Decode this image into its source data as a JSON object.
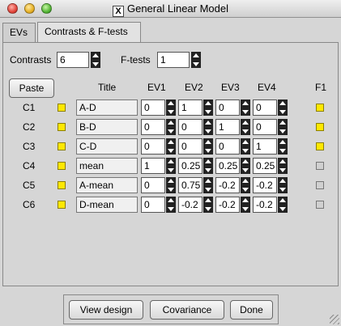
{
  "window": {
    "title": "General Linear Model"
  },
  "tabs": [
    {
      "label": "EVs"
    },
    {
      "label": "Contrasts & F-tests"
    }
  ],
  "counts": {
    "contrasts_label": "Contrasts",
    "contrasts_value": "6",
    "ftests_label": "F-tests",
    "ftests_value": "1"
  },
  "header": {
    "paste_label": "Paste",
    "title_label": "Title",
    "ev_labels": [
      "EV1",
      "EV2",
      "EV3",
      "EV4"
    ],
    "f_label": "F1"
  },
  "rows": [
    {
      "label": "C1",
      "title": "A-D",
      "ev": [
        "0",
        "1",
        "0",
        "0"
      ],
      "checked": true
    },
    {
      "label": "C2",
      "title": "B-D",
      "ev": [
        "0",
        "0",
        "1",
        "0"
      ],
      "checked": true
    },
    {
      "label": "C3",
      "title": "C-D",
      "ev": [
        "0",
        "0",
        "0",
        "1"
      ],
      "checked": true
    },
    {
      "label": "C4",
      "title": "mean",
      "ev": [
        "1",
        "0.25",
        "0.25",
        "0.25"
      ],
      "checked": false
    },
    {
      "label": "C5",
      "title": "A-mean",
      "ev": [
        "0",
        "0.75",
        "-0.2",
        "-0.2"
      ],
      "checked": false
    },
    {
      "label": "C6",
      "title": "D-mean",
      "ev": [
        "0",
        "-0.2",
        "-0.2",
        "-0.2"
      ],
      "checked": false
    }
  ],
  "footer": {
    "view_design": "View design",
    "covariance": "Covariance",
    "done": "Done"
  }
}
